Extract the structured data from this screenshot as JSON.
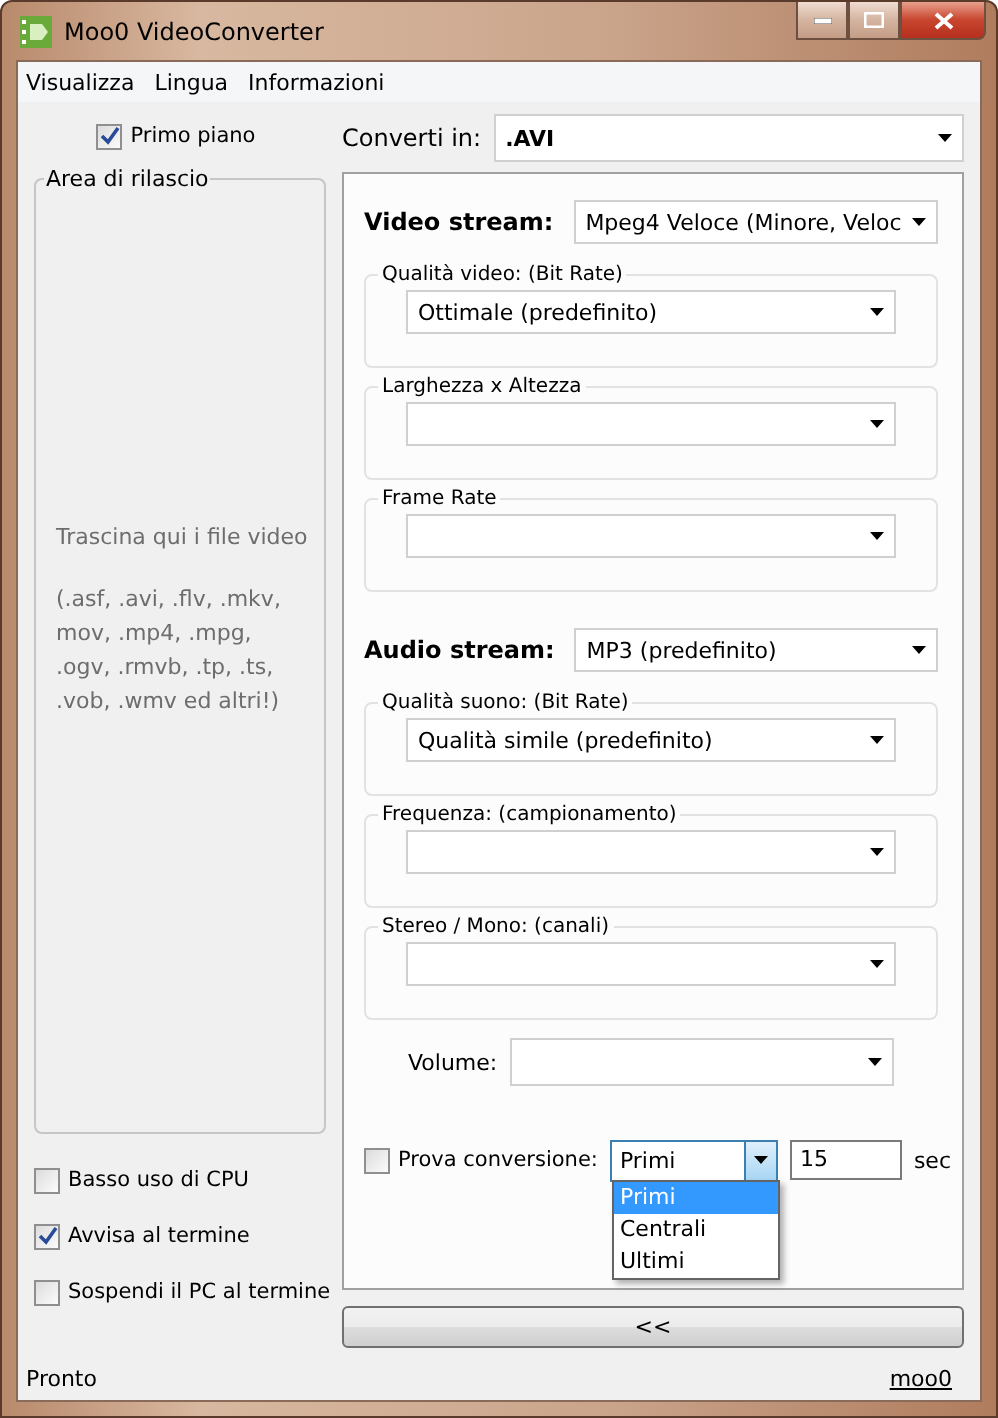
{
  "window": {
    "title": "Moo0 VideoConverter"
  },
  "menu": [
    "Visualizza",
    "Lingua",
    "Informazioni"
  ],
  "always_on_top": {
    "label": "Primo piano",
    "checked": true
  },
  "drop_area": {
    "title": "Area di rilascio",
    "hint": "Trascina qui i file video",
    "formats": "(.asf, .avi, .flv, .mkv, mov, .mp4, .mpg, .ogv, .rmvb, .tp, .ts, .vob, .wmv ed altri!)"
  },
  "options": [
    {
      "label": "Basso uso di CPU",
      "checked": false
    },
    {
      "label": "Avvisa al termine",
      "checked": true
    },
    {
      "label": "Sospendi il PC al termine",
      "checked": false
    }
  ],
  "convert_to": {
    "label": "Converti in:",
    "value": ".AVI"
  },
  "video_stream": {
    "label": "Video stream:",
    "value": "Mpeg4  Veloce  (Minore, Veloc"
  },
  "video_settings": [
    {
      "label": "Qualità video:  (Bit Rate)",
      "value": "Ottimale  (predefinito)"
    },
    {
      "label": "Larghezza x Altezza"
    },
    {
      "label": "Frame Rate"
    }
  ],
  "audio_stream": {
    "label": "Audio stream:",
    "value": "MP3   (predefinito)"
  },
  "audio_settings": [
    {
      "label": "Qualità suono:  (Bit Rate)",
      "value": "Qualità simile  (predefinito)"
    },
    {
      "label": "Frequenza:  (campionamento)"
    },
    {
      "label": "Stereo / Mono:  (canali)"
    }
  ],
  "volume": {
    "label": "Volume:"
  },
  "test_conversion": {
    "label": "Prova conversione:",
    "checked": false,
    "part": "Primi",
    "seconds": "15",
    "unit": "sec",
    "expanded": true,
    "choices": [
      {
        "label": "Primi",
        "selected": true
      },
      {
        "label": "Centrali",
        "selected": false
      },
      {
        "label": "Ultimi",
        "selected": false
      }
    ]
  },
  "convert_button": "<<",
  "status_bar": {
    "text": "Pronto",
    "link": "moo0"
  }
}
